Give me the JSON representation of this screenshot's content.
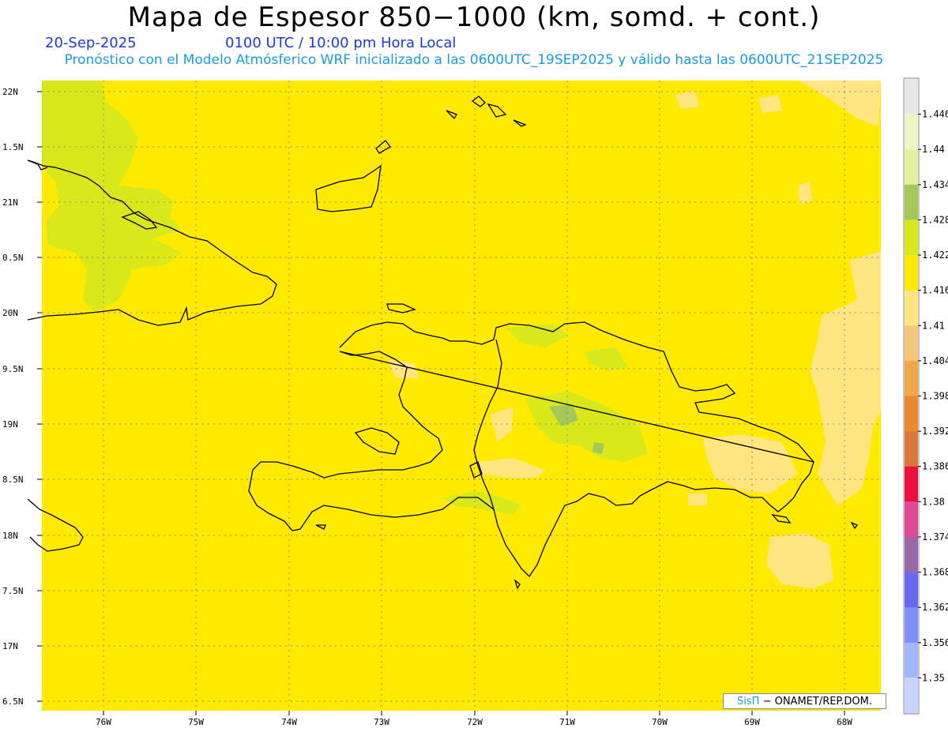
{
  "title": "Mapa de Espesor 850−1000 (km, somd. + cont.)",
  "date_label": "20-Sep-2025",
  "time_label": "0100 UTC / 10:00 pm Hora Local",
  "forecast_note": "Pronóstico con el Modelo Atmósferico WRF inicializado a las 0600UTC_19SEP2025 y válido hasta las  0600UTC_21SEP2025",
  "credit": {
    "brand": "SisΠ",
    "text": "− ONAMET/REP.DOM."
  },
  "axes": {
    "lat_labels": [
      "22N",
      "1.5N",
      "21N",
      "0.5N",
      "20N",
      "9.5N",
      "19N",
      "8.5N",
      "18N",
      "7.5N",
      "17N",
      "6.5N"
    ],
    "lon_labels": [
      "76W",
      "75W",
      "74W",
      "73W",
      "72W",
      "71W",
      "70W",
      "69W",
      "68W"
    ]
  },
  "legend": {
    "levels": [
      "1.446",
      "1.44",
      "1.434",
      "1.428",
      "1.422",
      "1.416",
      "1.41",
      "1.404",
      "1.398",
      "1.392",
      "1.386",
      "1.38",
      "1.374",
      "1.368",
      "1.362",
      "1.356",
      "1.35"
    ],
    "colors": [
      "#e8e8e8",
      "#f0f5c8",
      "#e3f0a0",
      "#a6c85a",
      "#d8e81a",
      "#ffea00",
      "#ffe680",
      "#f3c87a",
      "#efa84a",
      "#e8882f",
      "#d9783a",
      "#ee1040",
      "#e04a9a",
      "#9a6aa8",
      "#6868f0",
      "#8090f8",
      "#a0b8ff",
      "#c8d6ff"
    ]
  },
  "colors": {
    "field": "#ffea00",
    "light_band": "#ffe680",
    "green_light": "#d8e81a",
    "green_dark": "#a6c85a",
    "coast": "#000000",
    "grid": "#8a8a8a"
  }
}
